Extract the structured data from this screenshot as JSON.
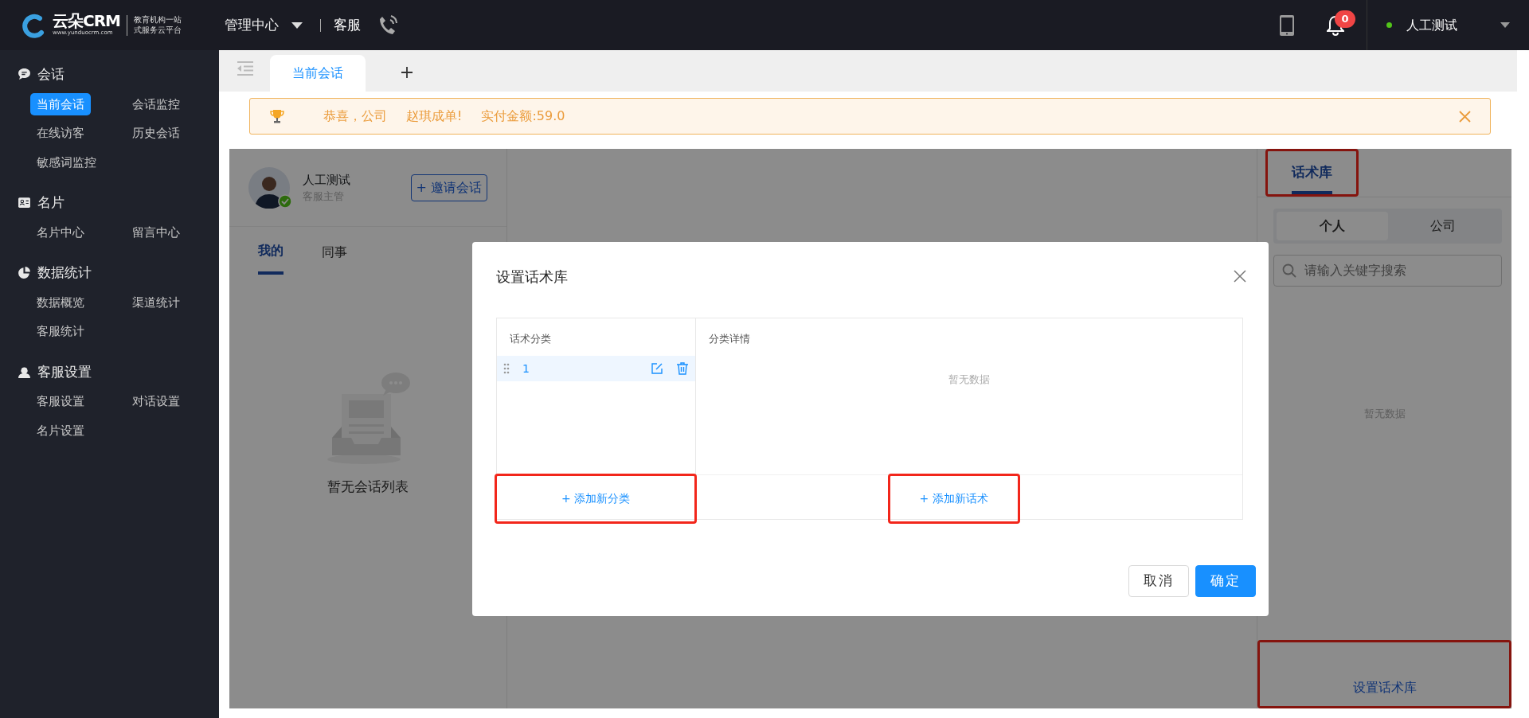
{
  "header": {
    "logo": {
      "name": "云朵CRM",
      "url": "www.yunduocrm.com",
      "slogan": [
        "教育机构一站",
        "式服务云平台"
      ]
    },
    "menu": {
      "label": "管理中心"
    },
    "section": "客服",
    "notification_count": "0",
    "user": {
      "name": "人工测试",
      "online": true
    }
  },
  "sidebar": {
    "groups": [
      {
        "kind": "chat",
        "title": "会话",
        "items": [
          {
            "label": "当前会话",
            "selected": true
          },
          {
            "label": "会话监控",
            "selected": false
          },
          {
            "label": "在线访客",
            "selected": false
          },
          {
            "label": "历史会话",
            "selected": false
          },
          {
            "label": "敏感词监控",
            "selected": false
          }
        ]
      },
      {
        "kind": "card",
        "title": "名片",
        "items": [
          {
            "label": "名片中心",
            "selected": false
          },
          {
            "label": "留言中心",
            "selected": false
          }
        ]
      },
      {
        "kind": "stats",
        "title": "数据统计",
        "items": [
          {
            "label": "数据概览",
            "selected": false
          },
          {
            "label": "渠道统计",
            "selected": false
          },
          {
            "label": "客服统计",
            "selected": false
          }
        ]
      },
      {
        "kind": "agent",
        "title": "客服设置",
        "items": [
          {
            "label": "客服设置",
            "selected": false
          },
          {
            "label": "对话设置",
            "selected": false
          },
          {
            "label": "名片设置",
            "selected": false
          }
        ]
      }
    ]
  },
  "tabs": [
    {
      "label": "当前会话",
      "selected": true
    }
  ],
  "notice": {
    "parts": [
      "恭喜，公司",
      "赵琪成单!",
      "实付金额:59.0"
    ]
  },
  "agent": {
    "name": "人工测试",
    "role": "客服主管",
    "online": true,
    "invite_label": "+ 邀请会话"
  },
  "conversation_tabs": [
    {
      "label": "我的",
      "selected": true
    },
    {
      "label": "同事",
      "selected": false
    }
  ],
  "conversation_empty": "暂无会话列表",
  "library": {
    "tabs": [
      {
        "label": "话术库",
        "selected": true,
        "highlighted": true
      }
    ],
    "scopes": [
      {
        "label": "个人",
        "selected": true
      },
      {
        "label": "公司",
        "selected": false
      }
    ],
    "search": {
      "placeholder": "请输入关键字搜索"
    },
    "empty_text": "暂无数据",
    "settings_button": {
      "label": "设置话术库",
      "highlighted": true
    }
  },
  "dialog": {
    "title": "设置话术库",
    "categories_header": "话术分类",
    "details_header": "分类详情",
    "categories": [
      {
        "label": "1",
        "selected": true
      }
    ],
    "details_empty": "暂无数据",
    "add_category": {
      "label": "+ 添加新分类",
      "highlighted": true
    },
    "add_script": {
      "label": "+ 添加新话术",
      "highlighted": true
    },
    "buttons": [
      {
        "label": "取消",
        "kind": "secondary"
      },
      {
        "label": "确定",
        "kind": "primary"
      }
    ]
  }
}
